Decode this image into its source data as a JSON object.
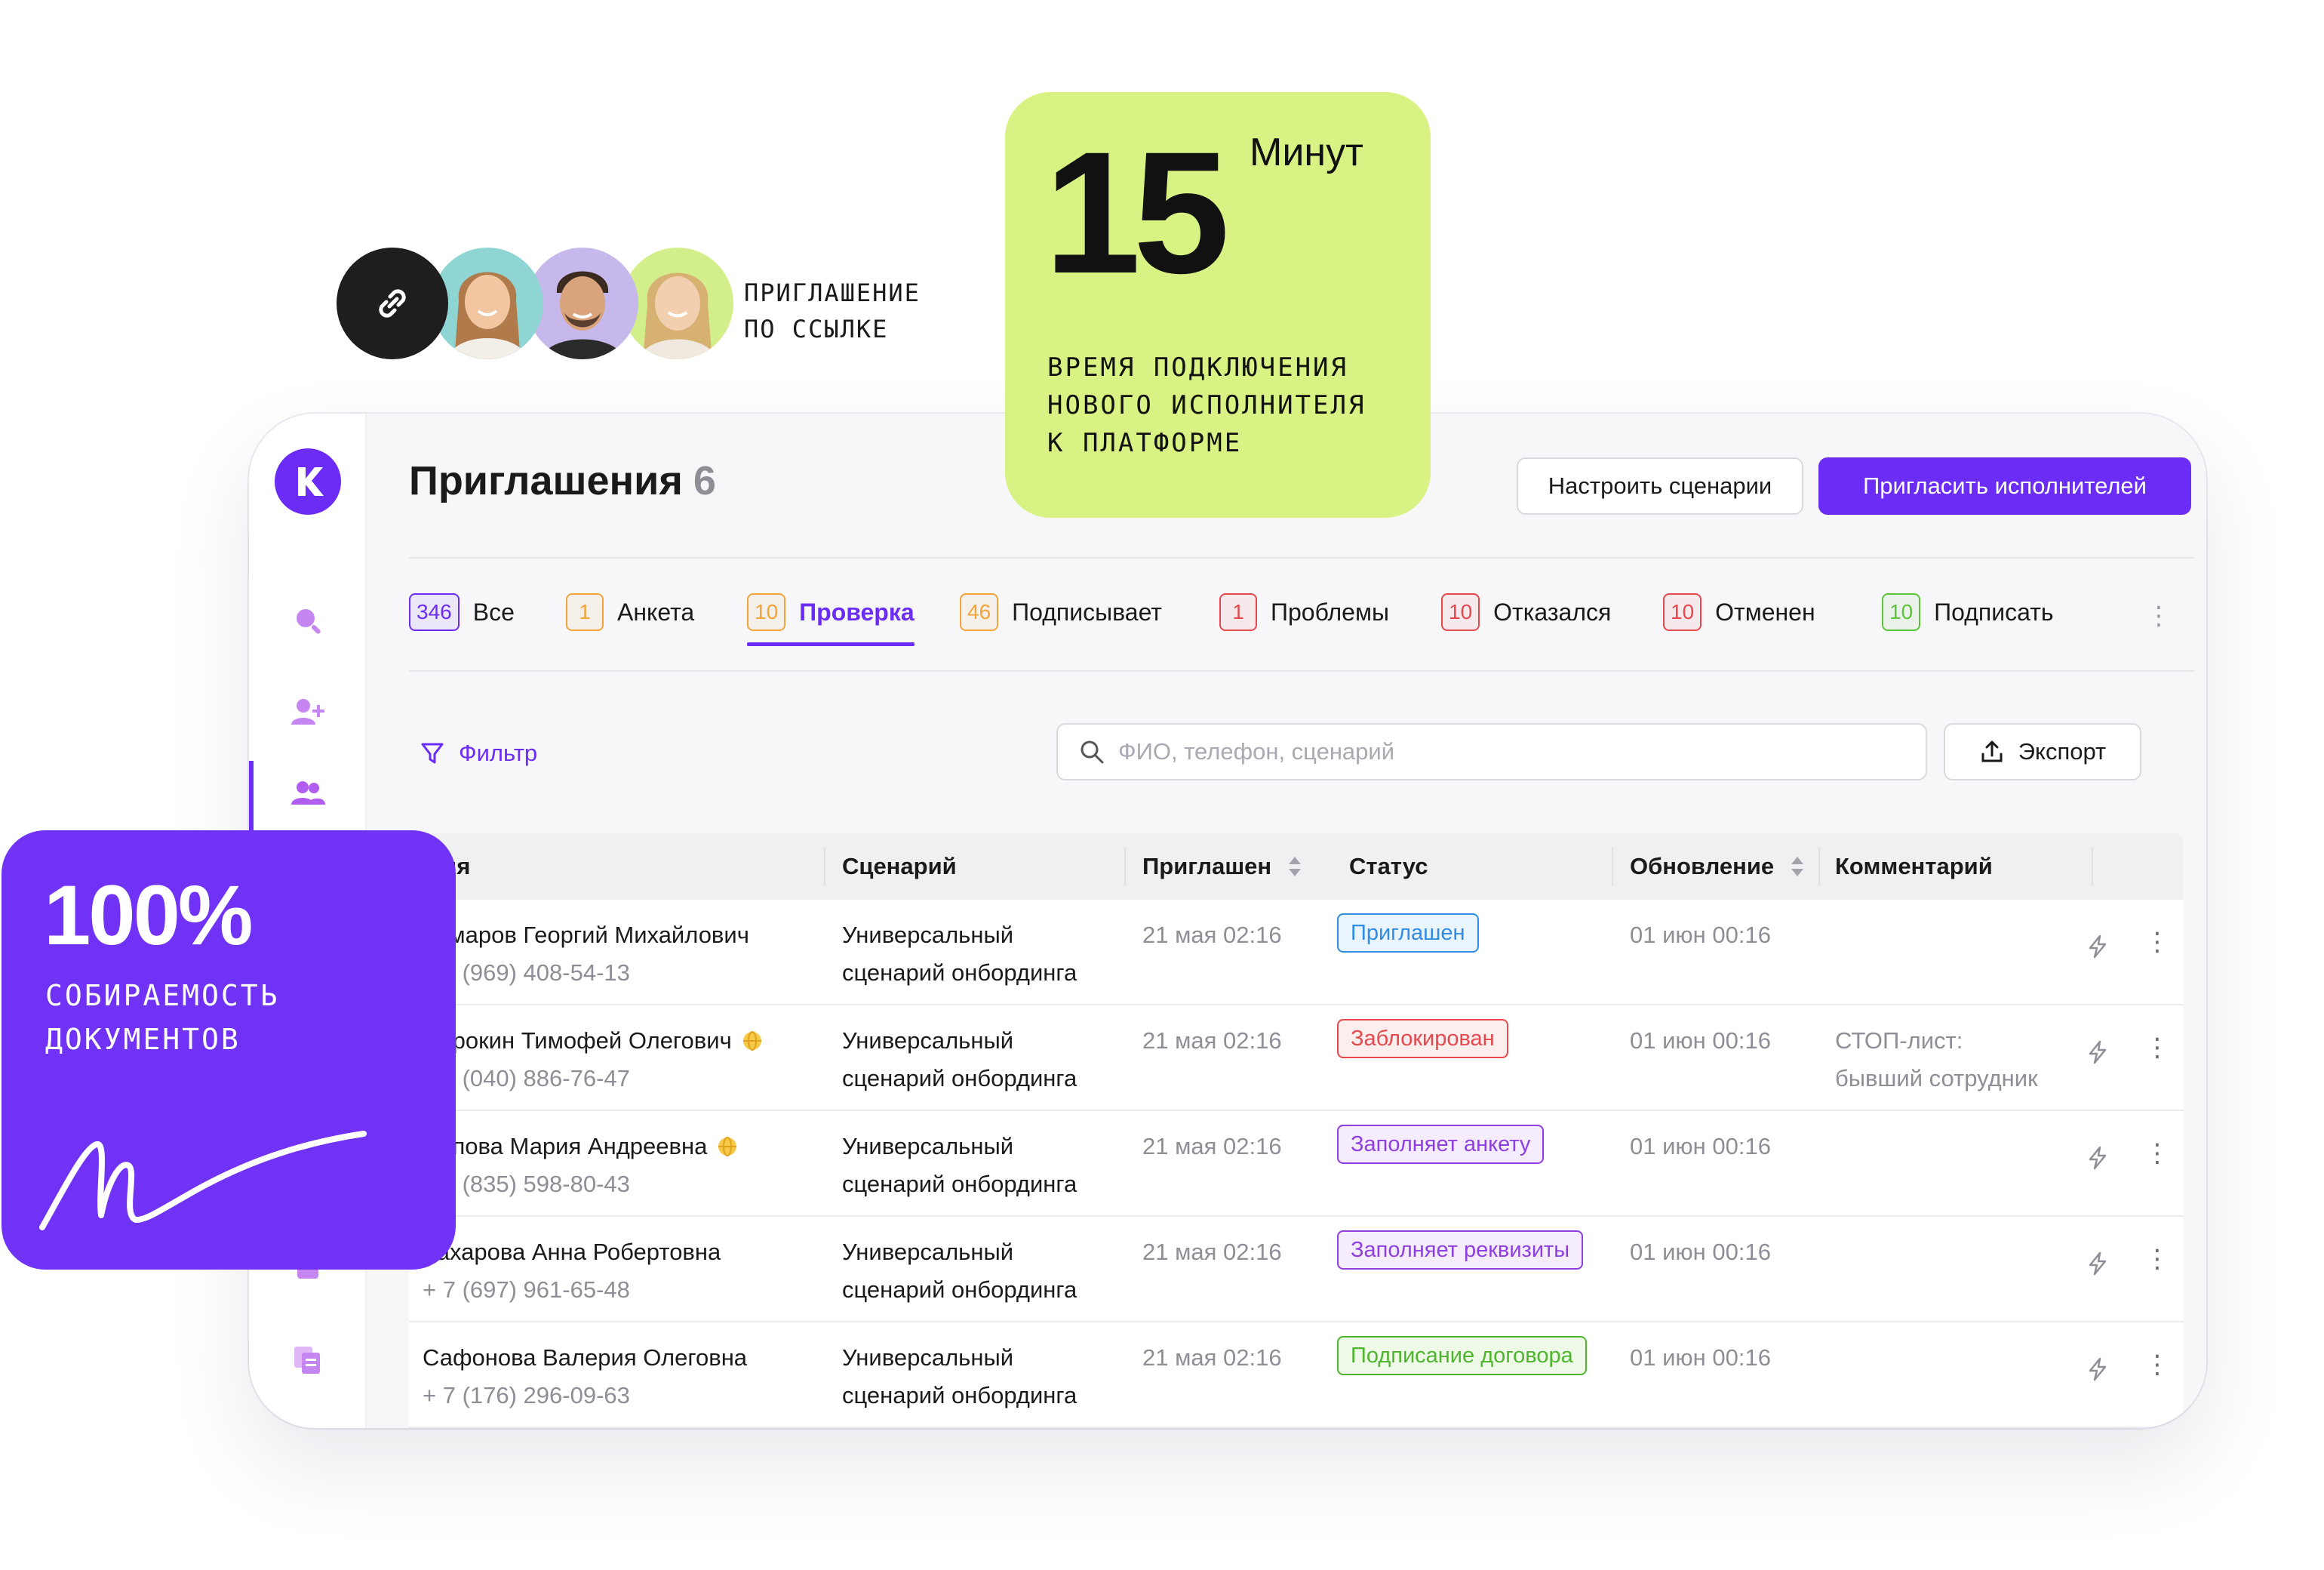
{
  "invite": {
    "text": "ПРИГЛАШЕНИЕ\nПО ССЫЛКЕ",
    "icon": "link-icon"
  },
  "stat_time": {
    "number": "15",
    "unit": "Минут",
    "description": "ВРЕМЯ ПОДКЛЮЧЕНИЯ\nНОВОГО ИСПОЛНИТЕЛЯ\nК ПЛАТФОРМЕ"
  },
  "stat_docs": {
    "number": "100%",
    "description": "СОБИРАЕМОСТЬ\nДОКУМЕНТОВ",
    "signature": "handwritten-signature"
  },
  "logo": {
    "letter": "K",
    "color": "#6b2cf5"
  },
  "sidebar": {
    "items": [
      "search-icon",
      "add-user-icon",
      "users-icon",
      "documents-icon",
      "copy-documents-icon"
    ],
    "active": 2
  },
  "header": {
    "title": "Приглашения",
    "count": "6",
    "configure_label": "Настроить сценарии",
    "invite_label": "Пригласить исполнителей"
  },
  "tabs": [
    {
      "count": "346",
      "label": "Все",
      "color": "#6b2cf5"
    },
    {
      "count": "1",
      "label": "Анкета",
      "color": "#f3a53a"
    },
    {
      "count": "10",
      "label": "Проверка",
      "color": "#f3a53a",
      "active": true
    },
    {
      "count": "46",
      "label": "Подписывает",
      "color": "#f3a53a"
    },
    {
      "count": "1",
      "label": "Проблемы",
      "color": "#e5484d"
    },
    {
      "count": "10",
      "label": "Отказался",
      "color": "#e5484d"
    },
    {
      "count": "10",
      "label": "Отменен",
      "color": "#e5484d"
    },
    {
      "count": "10",
      "label": "Подписать",
      "color": "#5cc33a"
    }
  ],
  "toolbar": {
    "filter_label": "Фильтр",
    "search_placeholder": "ФИО, телефон, сценарий",
    "export_label": "Экспорт"
  },
  "table": {
    "columns": [
      "Имя",
      "Сценарий",
      "Приглашен",
      "Статус",
      "Обновление",
      "Комментарий"
    ],
    "rows": [
      {
        "name": "Комаров Георгий Михайлович",
        "phone": "+ 7 (969) 408-54-13",
        "flag": false,
        "scenario1": "Универсальный",
        "scenario2": "сценарий онбординга",
        "invited": "21 мая 02:16",
        "status": "Приглашен",
        "status_color": "#2f8de4",
        "status_bg": "#eaf4fd",
        "updated": "01 июн 00:16",
        "comment1": "",
        "comment2": ""
      },
      {
        "name": "Сорокин Тимофей Олегович",
        "phone": "+ 7 (040) 886-76-47",
        "flag": true,
        "scenario1": "Универсальный",
        "scenario2": "сценарий онбординга",
        "invited": "21 мая 02:16",
        "status": "Заблокирован",
        "status_color": "#e5484d",
        "status_bg": "#fdeeee",
        "updated": "01 июн 00:16",
        "comment1": "СТОП-лист:",
        "comment2": "бывший сотрудник"
      },
      {
        "name": "Попова Мария Андреевна",
        "phone": "+ 7 (835) 598-80-43",
        "flag": true,
        "scenario1": "Универсальный",
        "scenario2": "сценарий онбординга",
        "invited": "21 мая 02:16",
        "status": "Заполняет анкету",
        "status_color": "#8e3fe0",
        "status_bg": "#f5ecfd",
        "updated": "01 июн 00:16",
        "comment1": "",
        "comment2": ""
      },
      {
        "name": "Захарова Анна Робертовна",
        "phone": "+ 7 (697) 961-65-48",
        "flag": false,
        "scenario1": "Универсальный",
        "scenario2": "сценарий онбординга",
        "invited": "21 мая 02:16",
        "status": "Заполняет реквизиты",
        "status_color": "#8e3fe0",
        "status_bg": "#f5ecfd",
        "updated": "01 июн 00:16",
        "comment1": "",
        "comment2": ""
      },
      {
        "name": "Сафонова Валерия Олеговна",
        "phone": "+ 7 (176) 296-09-63",
        "flag": false,
        "scenario1": "Универсальный",
        "scenario2": "сценарий онбординга",
        "invited": "21 мая 02:16",
        "status": "Подписание договора",
        "status_color": "#4fb52f",
        "status_bg": "#eef9e8",
        "updated": "01 июн 00:16",
        "comment1": "",
        "comment2": ""
      }
    ]
  }
}
